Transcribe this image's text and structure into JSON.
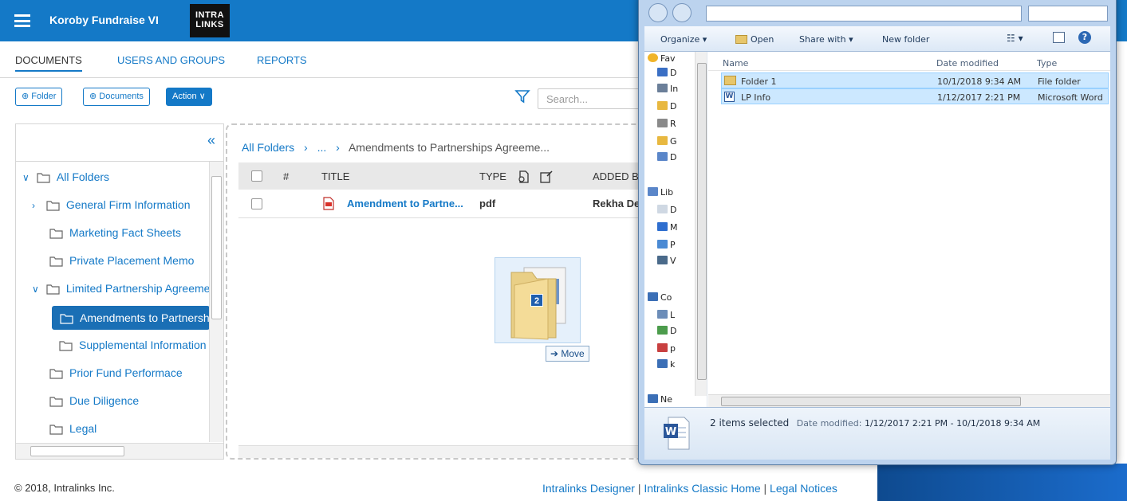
{
  "app": {
    "title": "Koroby Fundraise VI",
    "logo_text_1": "INTRA",
    "logo_text_2": "LINKS"
  },
  "nav": {
    "tabs": [
      {
        "label": "DOCUMENTS",
        "active": true
      },
      {
        "label": "USERS AND GROUPS",
        "active": false
      },
      {
        "label": "REPORTS",
        "active": false
      }
    ]
  },
  "toolbar": {
    "folder_label": "⊕ Folder",
    "documents_label": "⊕ Documents",
    "action_label": "Action ∨",
    "search_placeholder": "Search..."
  },
  "tree": {
    "collapse_glyph": "«",
    "items": [
      {
        "label": "All Folders",
        "chevron": "∨"
      },
      {
        "label": "General Firm Information",
        "chevron": "›"
      },
      {
        "label": "Marketing Fact Sheets",
        "chevron": ""
      },
      {
        "label": "Private Placement Memo",
        "chevron": ""
      },
      {
        "label": "Limited Partnership Agreement",
        "chevron": "∨"
      },
      {
        "label": "Amendments to Partnerships Agreement",
        "chevron": "",
        "selected": true
      },
      {
        "label": "Supplemental Information",
        "chevron": ""
      },
      {
        "label": "Prior Fund Performace",
        "chevron": ""
      },
      {
        "label": "Due Diligence",
        "chevron": ""
      },
      {
        "label": "Legal",
        "chevron": ""
      }
    ]
  },
  "breadcrumb": {
    "root": "All Folders",
    "sep1": "›",
    "ellipsis": "...",
    "sep2": "›",
    "current": "Amendments to Partnerships Agreeme..."
  },
  "grid": {
    "headers": {
      "number": "#",
      "title": "TITLE",
      "type": "TYPE",
      "added_by": "ADDED BY"
    },
    "rows": [
      {
        "title": "Amendment to Partne...",
        "type": "pdf",
        "added_by": "Rekha Dey"
      }
    ]
  },
  "drag": {
    "count": "2",
    "tooltip": "➔ Move"
  },
  "footer": {
    "copyright": "© 2018, Intralinks Inc.",
    "link_designer": "Intralinks Designer",
    "link_classic": "Intralinks Classic Home",
    "link_legal": "Legal Notices",
    "separator": " | "
  },
  "explorer": {
    "commands": {
      "organize": "Organize ▾",
      "open": "Open",
      "share_with": "Share with ▾",
      "new_folder": "New folder"
    },
    "nav_items": [
      {
        "label": "Fav",
        "top": true,
        "color": "#f0b429"
      },
      {
        "label": "D",
        "top": false,
        "color": "#3a6fc4"
      },
      {
        "label": "In",
        "top": false,
        "color": "#6b7f99"
      },
      {
        "label": "D",
        "top": false,
        "color": "#e8b840"
      },
      {
        "label": "R",
        "top": false,
        "color": "#8a8a8a"
      },
      {
        "label": "G",
        "top": false,
        "color": "#e8b840"
      },
      {
        "label": "D",
        "top": false,
        "color": "#5a86c9"
      },
      {
        "label": "Lib",
        "top": true,
        "color": "#5a86c9"
      },
      {
        "label": "D",
        "top": false,
        "color": "#cfd8e3"
      },
      {
        "label": "M",
        "top": false,
        "color": "#2e6ecf"
      },
      {
        "label": "P",
        "top": false,
        "color": "#4a8ad4"
      },
      {
        "label": "V",
        "top": false,
        "color": "#4a6a8a"
      },
      {
        "label": "Co",
        "top": true,
        "color": "#3b6fb6"
      },
      {
        "label": "L",
        "top": false,
        "color": "#6c8db8"
      },
      {
        "label": "D",
        "top": false,
        "color": "#4c9c4c"
      },
      {
        "label": "p",
        "top": false,
        "color": "#c84040"
      },
      {
        "label": "k",
        "top": false,
        "color": "#3b6fb6"
      },
      {
        "label": "Ne",
        "top": true,
        "color": "#3b6fb6"
      }
    ],
    "columns": {
      "name": "Name",
      "date_modified": "Date modified",
      "type": "Type"
    },
    "files": [
      {
        "name": "Folder 1",
        "date": "10/1/2018 9:34 AM",
        "type": "File folder",
        "kind": "folder"
      },
      {
        "name": "LP Info",
        "date": "1/12/2017 2:21 PM",
        "type": "Microsoft Word",
        "kind": "word"
      }
    ],
    "status": {
      "selected": "2 items selected",
      "date_label": "Date modified:",
      "date_range": "1/12/2017 2:21 PM - 10/1/2018 9:34 AM"
    }
  },
  "colors": {
    "brand_blue": "#1479c7",
    "selected_row": "#1a6fb5",
    "explorer_frame": "#bcd3ee",
    "file_selection": "#cce8ff"
  }
}
